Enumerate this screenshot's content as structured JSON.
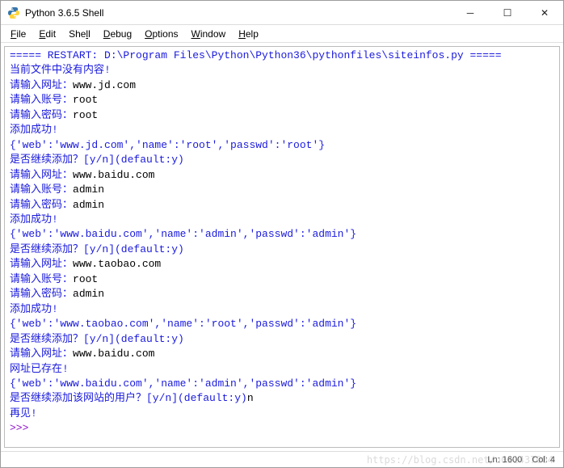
{
  "window": {
    "title": "Python 3.6.5 Shell"
  },
  "menu": {
    "file": "File",
    "edit": "Edit",
    "shell": "Shell",
    "debug": "Debug",
    "options": "Options",
    "window": "Window",
    "help": "Help"
  },
  "lines": [
    {
      "cls": "blue",
      "text": "===== RESTART: D:\\Program Files\\Python\\Python36\\pythonfiles\\siteinfos.py ====="
    },
    {
      "cls": "blue",
      "text": "当前文件中没有内容!"
    },
    {
      "cls": "",
      "prompt": "请输入网址：",
      "value": "www.jd.com"
    },
    {
      "cls": "",
      "prompt": "请输入账号：",
      "value": "root"
    },
    {
      "cls": "",
      "prompt": "请输入密码：",
      "value": "root"
    },
    {
      "cls": "blue",
      "text": "添加成功!"
    },
    {
      "cls": "blue",
      "text": "{'web':'www.jd.com','name':'root','passwd':'root'}"
    },
    {
      "cls": "blue",
      "text": "是否继续添加？[y/n](default:y)"
    },
    {
      "cls": "",
      "prompt": "请输入网址：",
      "value": "www.baidu.com"
    },
    {
      "cls": "",
      "prompt": "请输入账号：",
      "value": "admin"
    },
    {
      "cls": "",
      "prompt": "请输入密码：",
      "value": "admin"
    },
    {
      "cls": "blue",
      "text": "添加成功!"
    },
    {
      "cls": "blue",
      "text": "{'web':'www.baidu.com','name':'admin','passwd':'admin'}"
    },
    {
      "cls": "blue",
      "text": "是否继续添加？[y/n](default:y)"
    },
    {
      "cls": "",
      "prompt": "请输入网址：",
      "value": "www.taobao.com"
    },
    {
      "cls": "",
      "prompt": "请输入账号：",
      "value": "root"
    },
    {
      "cls": "",
      "prompt": "请输入密码：",
      "value": "admin"
    },
    {
      "cls": "blue",
      "text": "添加成功!"
    },
    {
      "cls": "blue",
      "text": "{'web':'www.taobao.com','name':'root','passwd':'admin'}"
    },
    {
      "cls": "blue",
      "text": "是否继续添加？[y/n](default:y)"
    },
    {
      "cls": "",
      "prompt": "请输入网址：",
      "value": "www.baidu.com"
    },
    {
      "cls": "blue",
      "text": "网址已存在!"
    },
    {
      "cls": "blue",
      "text": "{'web':'www.baidu.com','name':'admin','passwd':'admin'}"
    },
    {
      "cls": "",
      "prompt": "是否继续添加该网站的用户？[y/n](default:y)",
      "value": "n"
    },
    {
      "cls": "blue",
      "text": "再见!"
    },
    {
      "cls": "purple",
      "text": ">>> "
    }
  ],
  "status": {
    "line": "Ln: 1600",
    "col": "Col: 4"
  },
  "watermark": "https://blog.csdn.net/u011437004"
}
